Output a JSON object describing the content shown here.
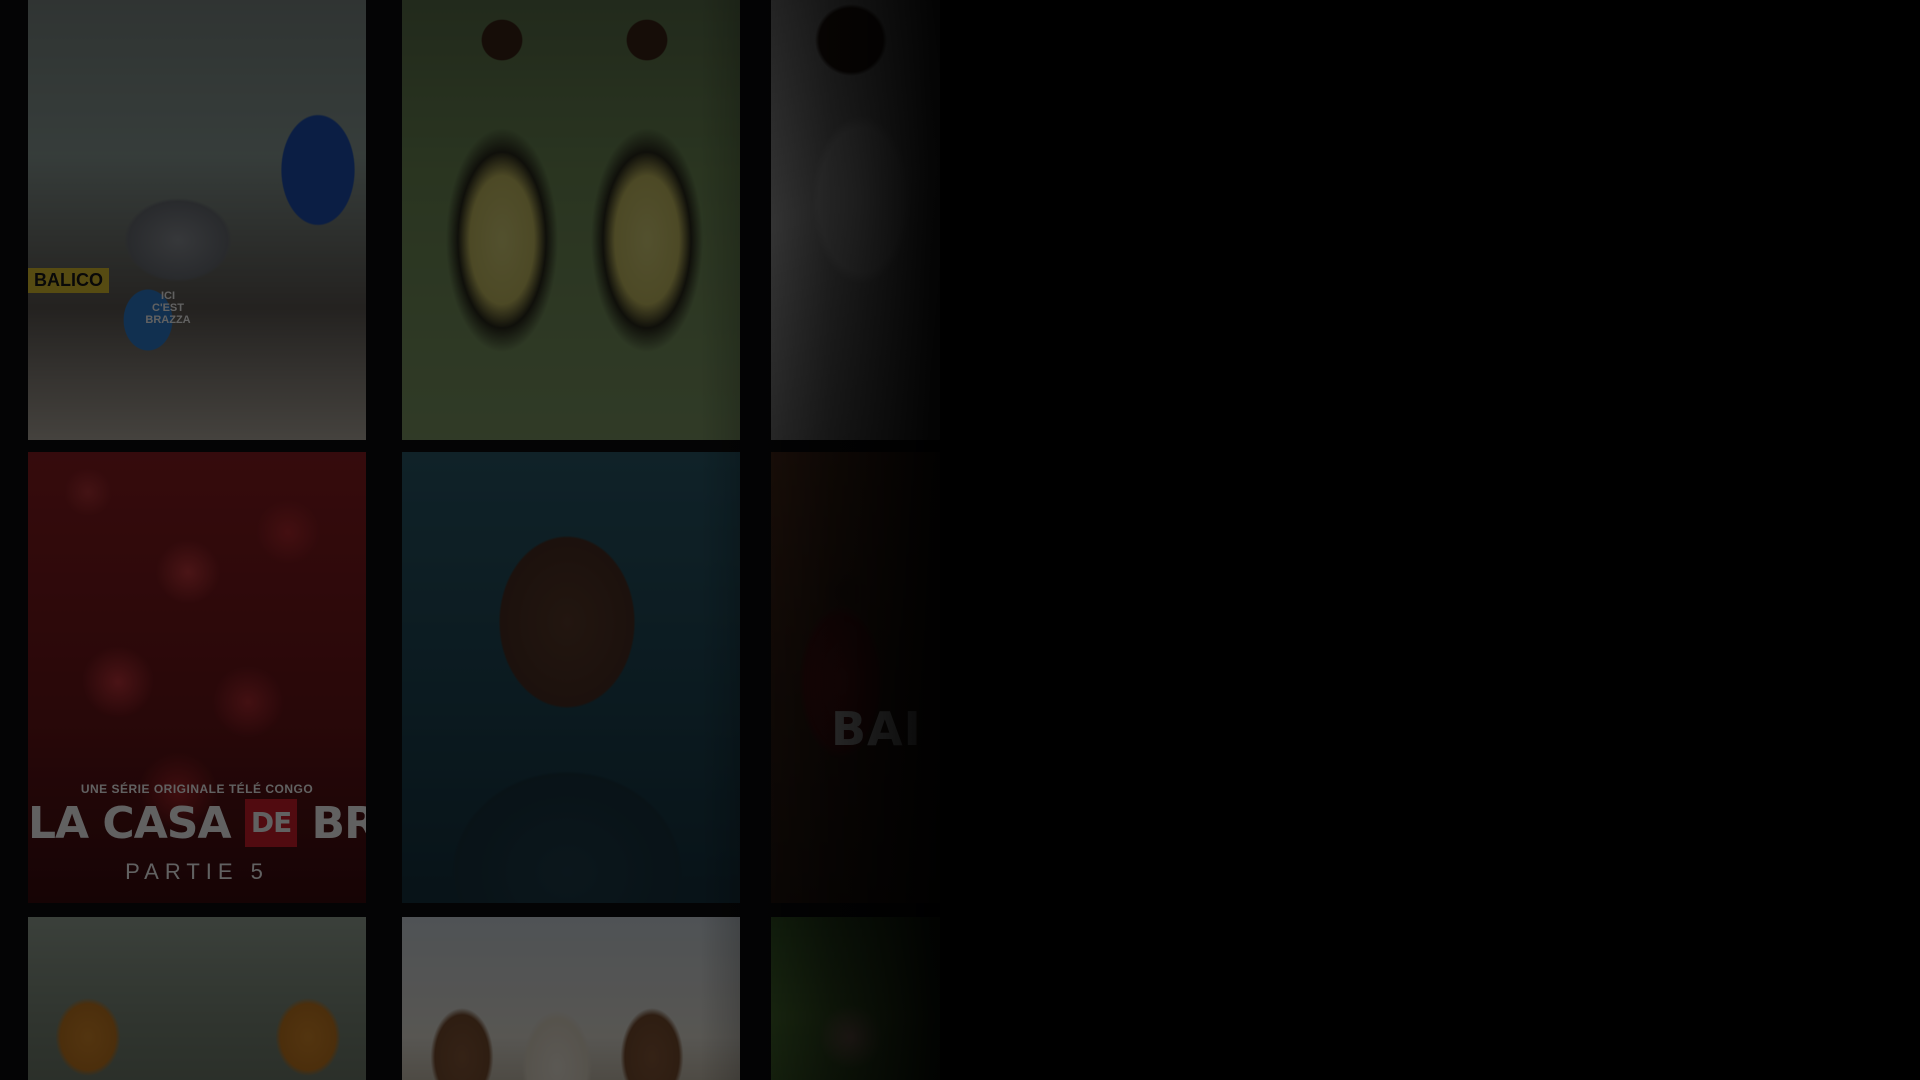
{
  "posters": [
    {
      "name": "poster-car",
      "shirt_text": "ICI\nC'EST\nBRAZZA",
      "plate": "BALICO"
    },
    {
      "name": "poster-shirts"
    },
    {
      "name": "poster-plane"
    },
    {
      "name": "poster-casa",
      "subtitle": "UNE SÉRIE ORIGINALE TÉLÉ CONGO",
      "title_left": "LA CASA",
      "title_de": "DE",
      "title_right": "BRAZZA",
      "part": "PARTIE 5"
    },
    {
      "name": "poster-portrait"
    },
    {
      "name": "poster-bad",
      "title": "BAI"
    },
    {
      "name": "poster-vests"
    },
    {
      "name": "poster-trio"
    },
    {
      "name": "poster-grass"
    }
  ],
  "colors": {
    "background": "#0d0d0e",
    "overlay": "#000000",
    "casa_red": "#d41f2b"
  }
}
